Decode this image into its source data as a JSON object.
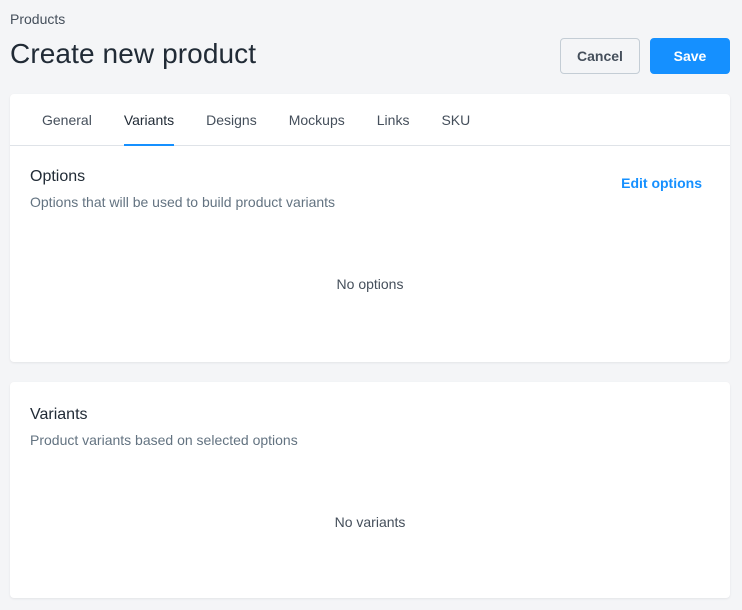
{
  "breadcrumb": {
    "label": "Products"
  },
  "header": {
    "title": "Create new product",
    "cancel_label": "Cancel",
    "save_label": "Save"
  },
  "tabs": [
    {
      "label": "General",
      "active": false
    },
    {
      "label": "Variants",
      "active": true
    },
    {
      "label": "Designs",
      "active": false
    },
    {
      "label": "Mockups",
      "active": false
    },
    {
      "label": "Links",
      "active": false
    },
    {
      "label": "SKU",
      "active": false
    }
  ],
  "options_section": {
    "title": "Options",
    "description": "Options that will be used to build product variants",
    "edit_link": "Edit options",
    "empty_text": "No options"
  },
  "variants_section": {
    "title": "Variants",
    "description": "Product variants based on selected options",
    "empty_text": "No variants"
  },
  "colors": {
    "accent": "#1590ff",
    "background": "#f4f5f7",
    "card": "#ffffff"
  }
}
